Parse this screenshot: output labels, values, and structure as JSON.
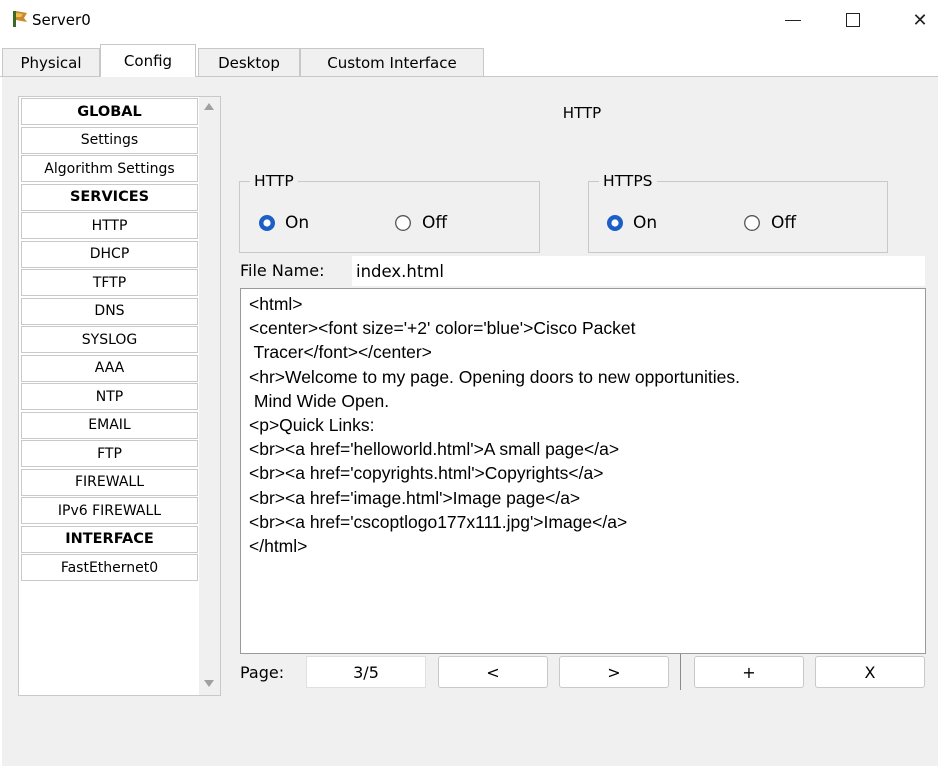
{
  "window": {
    "title": "Server0",
    "icon": "server-app-icon",
    "controls": {
      "minimize": "minimize-icon",
      "maximize": "maximize-icon",
      "close_glyph": "✕"
    }
  },
  "tabs": [
    {
      "label": "Physical",
      "active": false
    },
    {
      "label": "Config",
      "active": true
    },
    {
      "label": "Desktop",
      "active": false
    },
    {
      "label": "Custom Interface",
      "active": false
    }
  ],
  "sidebar": {
    "items": [
      {
        "label": "GLOBAL",
        "header": true
      },
      {
        "label": "Settings",
        "header": false
      },
      {
        "label": "Algorithm Settings",
        "header": false
      },
      {
        "label": "SERVICES",
        "header": true
      },
      {
        "label": "HTTP",
        "header": false
      },
      {
        "label": "DHCP",
        "header": false
      },
      {
        "label": "TFTP",
        "header": false
      },
      {
        "label": "DNS",
        "header": false
      },
      {
        "label": "SYSLOG",
        "header": false
      },
      {
        "label": "AAA",
        "header": false
      },
      {
        "label": "NTP",
        "header": false
      },
      {
        "label": "EMAIL",
        "header": false
      },
      {
        "label": "FTP",
        "header": false
      },
      {
        "label": "FIREWALL",
        "header": false
      },
      {
        "label": "IPv6 FIREWALL",
        "header": false
      },
      {
        "label": "INTERFACE",
        "header": true
      },
      {
        "label": "FastEthernet0",
        "header": false
      }
    ]
  },
  "main": {
    "title": "HTTP",
    "http_group": {
      "legend": "HTTP",
      "on_label": "On",
      "off_label": "Off",
      "selected": "On"
    },
    "https_group": {
      "legend": "HTTPS",
      "on_label": "On",
      "off_label": "Off",
      "selected": "On"
    },
    "file_name": {
      "label": "File Name:",
      "value": "index.html"
    },
    "editor_lines": [
      "<html>",
      "<center><font size='+2' color='blue'>Cisco Packet",
      " Tracer</font></center>",
      "<hr>Welcome to my page. Opening doors to new opportunities.",
      " Mind Wide Open.",
      "<p>Quick Links:",
      "<br><a href='helloworld.html'>A small page</a>",
      "<br><a href='copyrights.html'>Copyrights</a>",
      "<br><a href='image.html'>Image page</a>",
      "<br><a href='cscoptlogo177x111.jpg'>Image</a>",
      "</html>"
    ],
    "pager": {
      "label": "Page:",
      "value": "3/5",
      "prev": "<",
      "next": ">",
      "add": "+",
      "remove": "X"
    }
  },
  "colors": {
    "radio_selected": "#1c5fc7",
    "panel_bg": "#f0f0f0",
    "border": "#c9c9c9"
  }
}
